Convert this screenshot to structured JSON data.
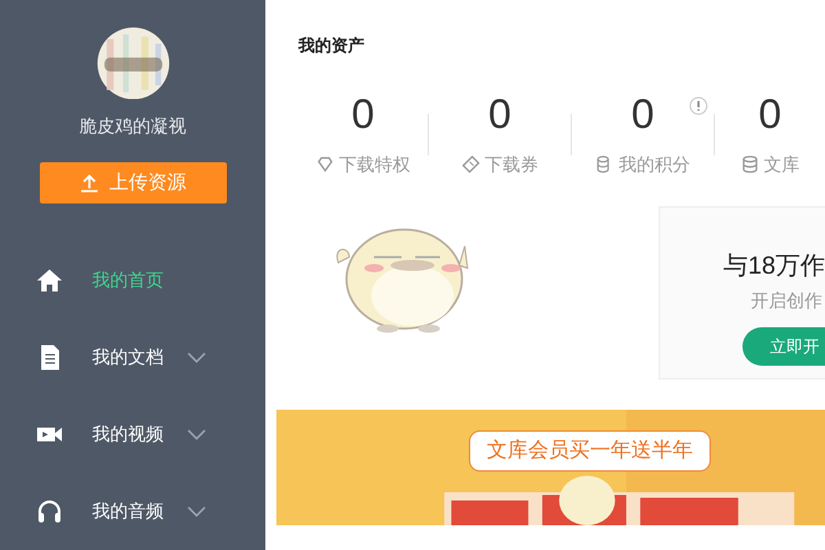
{
  "user": {
    "name": "脆皮鸡的凝视"
  },
  "upload_button": {
    "label": "上传资源"
  },
  "nav": [
    {
      "label": "我的首页",
      "kind": "link",
      "selected": true
    },
    {
      "label": "我的文档",
      "kind": "group",
      "selected": false,
      "expanded": false
    },
    {
      "label": "我的视频",
      "kind": "group",
      "selected": false,
      "expanded": false
    },
    {
      "label": "我的音频",
      "kind": "group",
      "selected": false,
      "expanded": false
    }
  ],
  "assets": {
    "title": "我的资产",
    "stats": [
      {
        "value": "0",
        "label": "下载特权",
        "kind": "privilege"
      },
      {
        "value": "0",
        "label": "下载券",
        "kind": "ticket"
      },
      {
        "value": "0",
        "label": "我的积分",
        "kind": "points",
        "info": true
      },
      {
        "value": "0",
        "label": "文库",
        "kind": "coins"
      }
    ]
  },
  "creator_card": {
    "title": "与18万作",
    "subtitle": "开启创作",
    "button": "立即开"
  },
  "banner": {
    "tagline": "文库会员买一年送半年"
  }
}
